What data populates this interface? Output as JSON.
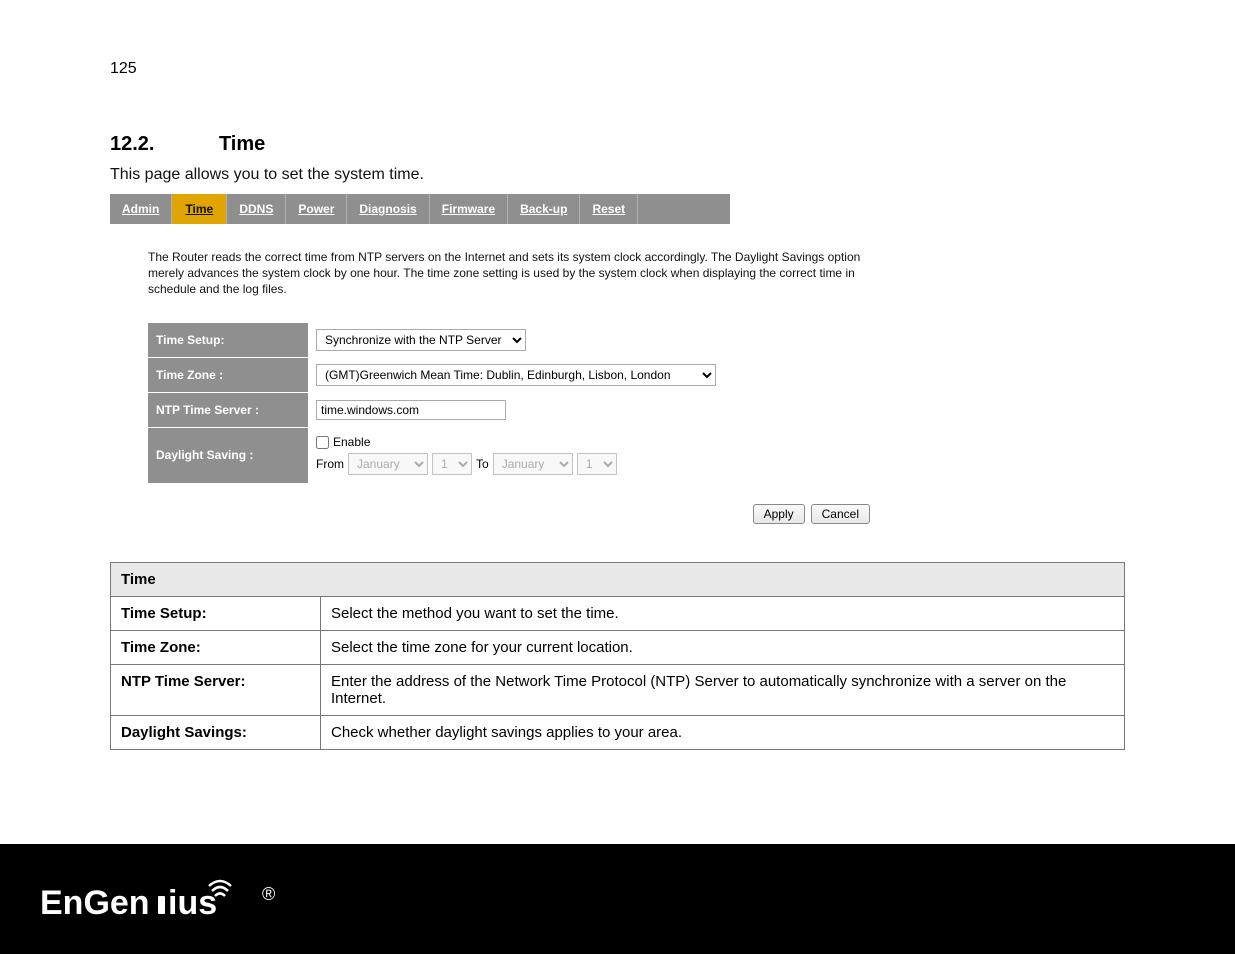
{
  "page_number": "125",
  "section": {
    "number": "12.2.",
    "title": "Time",
    "intro": "This page allows you to set the system time."
  },
  "tabs": [
    {
      "label": "Admin",
      "active": false
    },
    {
      "label": "Time",
      "active": true
    },
    {
      "label": "DDNS",
      "active": false
    },
    {
      "label": "Power",
      "active": false
    },
    {
      "label": "Diagnosis",
      "active": false
    },
    {
      "label": "Firmware",
      "active": false
    },
    {
      "label": "Back-up",
      "active": false
    },
    {
      "label": "Reset",
      "active": false
    }
  ],
  "explain_text": "The Router reads the correct time from NTP servers on the Internet and sets its system clock accordingly. The Daylight Savings option merely advances the system clock by one hour. The time zone setting is used by the system clock when displaying the correct time in schedule and the log files.",
  "settings": {
    "rows": [
      {
        "label": "Time Setup:",
        "type": "select",
        "value": "Synchronize with the NTP Server"
      },
      {
        "label": "Time Zone :",
        "type": "select_wide",
        "value": "(GMT)Greenwich Mean Time: Dublin, Edinburgh, Lisbon, London"
      },
      {
        "label": "NTP Time Server :",
        "type": "input",
        "value": "time.windows.com"
      },
      {
        "label": "Daylight Saving :",
        "type": "daylight"
      }
    ],
    "daylight": {
      "enable_label": "Enable",
      "enabled": false,
      "from_label": "From",
      "to_label": "To",
      "from_month": "January",
      "from_day": "1",
      "to_month": "January",
      "to_day": "1"
    }
  },
  "buttons": {
    "apply": "Apply",
    "cancel": "Cancel"
  },
  "desc_table": {
    "header": "Time",
    "rows": [
      {
        "label": "Time Setup:",
        "desc": "Select the method you want to set the time."
      },
      {
        "label": "Time Zone:",
        "desc": "Select the time zone for your current location."
      },
      {
        "label": "NTP Time Server:",
        "desc": "Enter the address of the Network Time Protocol (NTP) Server to automatically synchronize with a server on the Internet."
      },
      {
        "label": "Daylight Savings:",
        "desc": "Check whether daylight savings applies to your area."
      }
    ]
  },
  "footer": {
    "brand": "EnGenius"
  }
}
